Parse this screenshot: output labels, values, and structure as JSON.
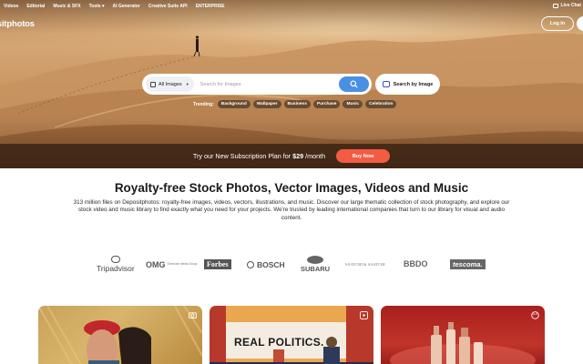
{
  "topnav": {
    "items": [
      "Videos",
      "Editorial",
      "Music & SFX",
      "Tools ▾",
      "AI Generator",
      "Creative Suite API",
      "ENTERPRISE"
    ],
    "live_chat": "Live Chat"
  },
  "header": {
    "logo_text": "depositphotos",
    "login_label": "Log In"
  },
  "search": {
    "category": "All Images",
    "placeholder": "Search for Images",
    "search_by_image": "Search by Image"
  },
  "trending": {
    "label": "Trending:",
    "chips": [
      "Background",
      "Wallpaper",
      "Business",
      "Purchase",
      "Music",
      "Celebration"
    ]
  },
  "promo": {
    "text_before": "Try our New Subscription Plan for ",
    "price": "$29",
    "text_after": " /month",
    "button": "Buy Now"
  },
  "main": {
    "headline": "Royalty-free Stock Photos, Vector Images, Videos and Music",
    "description": "313 million files on Depositphotos: royalty-free images, videos, vectors, illustrations, and music. Discover our large thematic collection of stock photography, and explore our stock video and music library to find exactly what you need for your projects. We're trusted by leading international companies that turn to our library for visual and audio content."
  },
  "partners": {
    "tripadvisor": "Tripadvisor",
    "omnicom": "OMG",
    "omnicom_sub": "Omnicom Media Group",
    "forbes": "Forbes",
    "bosch": "BOSCH",
    "subaru": "SUBARU",
    "saatchi": "SAATCHI & SAATCHI",
    "bbdo": "BBDO",
    "tescoma": "tescoma."
  },
  "cards": {
    "politics_text": "REAL POLITICS."
  },
  "colors": {
    "accent_blue": "#4a90e2",
    "buy_button": "#f25c43"
  }
}
